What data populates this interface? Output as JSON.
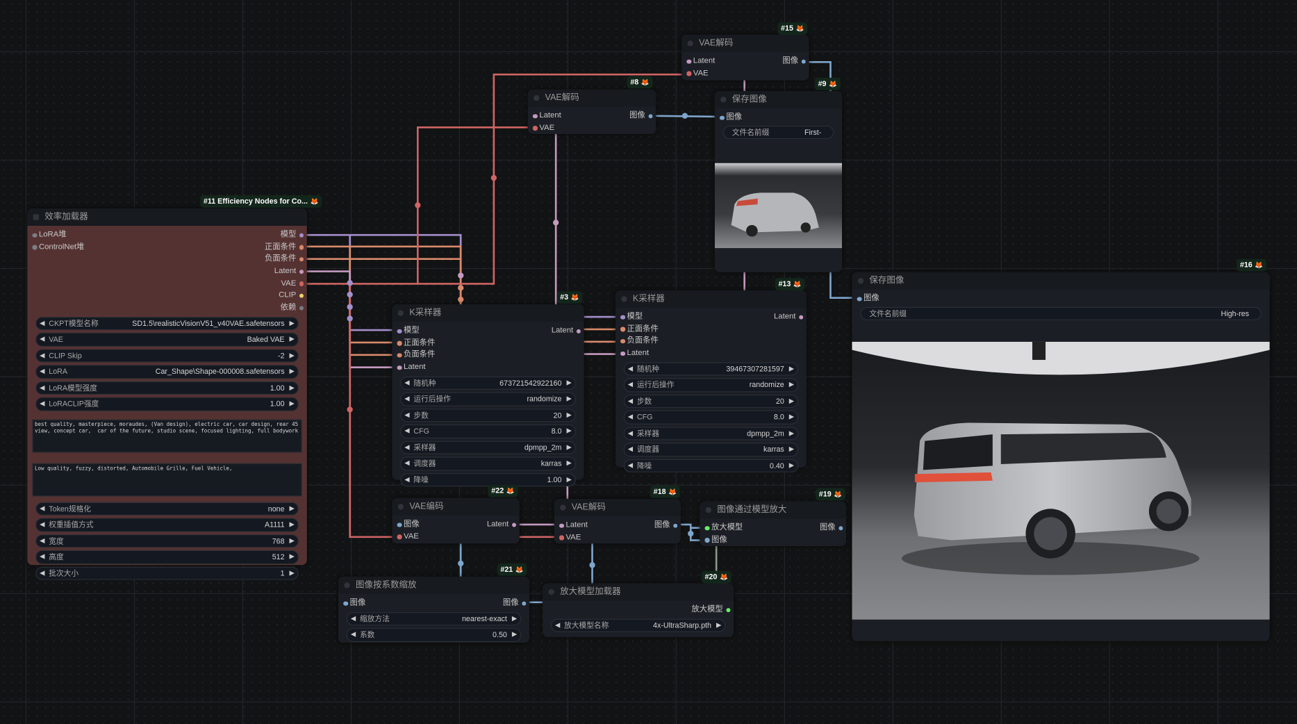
{
  "slot_colors": {
    "MODEL": "#a58fcb",
    "CONDITIONING": "#d88a6c",
    "LATENT": "#c49ac0",
    "VAE": "#d06464",
    "CLIP": "#eed66a",
    "IMAGE": "#7ea6cc",
    "UPSCALE_MODEL": "#66ee66",
    "DEPENDENCIES": "#7a7d86",
    "STACK": "#7a7d86"
  },
  "nodes": {
    "n11": {
      "badge": "#11 Efficiency Nodes for Co...",
      "title": "效率加载器",
      "rows": [
        {
          "in": "LoRA堆",
          "in_type": "STACK",
          "out": "模型",
          "out_type": "MODEL"
        },
        {
          "in": "ControlNet堆",
          "in_type": "STACK",
          "out": "正面条件",
          "out_type": "CONDITIONING"
        },
        {
          "out": "负面条件",
          "out_type": "CONDITIONING"
        },
        {
          "out": "Latent",
          "out_type": "LATENT"
        },
        {
          "out": "VAE",
          "out_type": "VAE"
        },
        {
          "out": "CLIP",
          "out_type": "CLIP"
        },
        {
          "out": "依赖",
          "out_type": "DEPENDENCIES"
        }
      ],
      "body": [
        {
          "label": "CKPT模型名称",
          "value": "SD1.5\\realisticVisionV51_v40VAE.safetensors"
        },
        {
          "label": "VAE",
          "value": "Baked VAE"
        },
        {
          "label": "CLIP Skip",
          "value": "-2"
        },
        {
          "label": "LoRA",
          "value": "Car_Shape\\Shape-000008.safetensors"
        },
        {
          "label": "LoRA模型强度",
          "value": "1.00"
        },
        {
          "label": "LoRACLIP强度",
          "value": "1.00"
        },
        {
          "text": "best quality, masterpiece, moraudes, (Van design), electric car, car design, rear 45 view, concept car,  car of the future, studio scene, focused lighting, full bodywork"
        },
        {
          "text": "Low quality, fuzzy, distorted, Automobile Grille, Fuel Vehicle,"
        },
        {
          "label": "Token规格化",
          "value": "none"
        },
        {
          "label": "权重插值方式",
          "value": "A1111"
        },
        {
          "label": "宽度",
          "value": "768"
        },
        {
          "label": "高度",
          "value": "512"
        },
        {
          "label": "批次大小",
          "value": "1"
        }
      ]
    },
    "n3": {
      "badge": "#3",
      "title": "K采样器",
      "rows": [
        {
          "in": "模型",
          "in_type": "MODEL",
          "out": "Latent",
          "out_type": "LATENT"
        },
        {
          "in": "正面条件",
          "in_type": "CONDITIONING"
        },
        {
          "in": "负面条件",
          "in_type": "CONDITIONING"
        },
        {
          "in": "Latent",
          "in_type": "LATENT"
        }
      ],
      "body": [
        {
          "label": "随机种",
          "value": "673721542922160"
        },
        {
          "label": "运行后操作",
          "value": "randomize"
        },
        {
          "label": "步数",
          "value": "20"
        },
        {
          "label": "CFG",
          "value": "8.0"
        },
        {
          "label": "采样器",
          "value": "dpmpp_2m"
        },
        {
          "label": "调度器",
          "value": "karras"
        },
        {
          "label": "降噪",
          "value": "1.00"
        }
      ]
    },
    "n13": {
      "badge": "#13",
      "title": "K采样器",
      "rows": [
        {
          "in": "模型",
          "in_type": "MODEL",
          "out": "Latent",
          "out_type": "LATENT"
        },
        {
          "in": "正面条件",
          "in_type": "CONDITIONING"
        },
        {
          "in": "负面条件",
          "in_type": "CONDITIONING"
        },
        {
          "in": "Latent",
          "in_type": "LATENT"
        }
      ],
      "body": [
        {
          "label": "随机种",
          "value": "39467307281597"
        },
        {
          "label": "运行后操作",
          "value": "randomize"
        },
        {
          "label": "步数",
          "value": "20"
        },
        {
          "label": "CFG",
          "value": "8.0"
        },
        {
          "label": "采样器",
          "value": "dpmpp_2m"
        },
        {
          "label": "调度器",
          "value": "karras"
        },
        {
          "label": "降噪",
          "value": "0.40"
        }
      ]
    },
    "n15": {
      "badge": "#15",
      "title": "VAE解码",
      "rows": [
        {
          "in": "Latent",
          "in_type": "LATENT",
          "out": "图像",
          "out_type": "IMAGE"
        },
        {
          "in": "VAE",
          "in_type": "VAE"
        }
      ],
      "body": []
    },
    "n8": {
      "badge": "#8",
      "title": "VAE解码",
      "rows": [
        {
          "in": "Latent",
          "in_type": "LATENT",
          "out": "图像",
          "out_type": "IMAGE"
        },
        {
          "in": "VAE",
          "in_type": "VAE"
        }
      ],
      "body": []
    },
    "n9": {
      "badge": "#9",
      "title": "保存图像",
      "rows": [
        {
          "in": "图像",
          "in_type": "IMAGE"
        }
      ],
      "body": [
        {
          "label": "文件名前缀",
          "value": "First-",
          "plain": true
        }
      ]
    },
    "n16": {
      "badge": "#16",
      "title": "保存图像",
      "rows": [
        {
          "in": "图像",
          "in_type": "IMAGE"
        }
      ],
      "body": [
        {
          "label": "文件名前缀",
          "value": "High-res",
          "plain": true
        }
      ]
    },
    "n22": {
      "badge": "#22",
      "title": "VAE编码",
      "rows": [
        {
          "in": "图像",
          "in_type": "IMAGE",
          "out": "Latent",
          "out_type": "LATENT"
        },
        {
          "in": "VAE",
          "in_type": "VAE"
        }
      ],
      "body": []
    },
    "n18": {
      "badge": "#18",
      "title": "VAE解码",
      "rows": [
        {
          "in": "Latent",
          "in_type": "LATENT",
          "out": "图像",
          "out_type": "IMAGE"
        },
        {
          "in": "VAE",
          "in_type": "VAE"
        }
      ],
      "body": []
    },
    "n19": {
      "badge": "#19",
      "title": "图像通过模型放大",
      "rows": [
        {
          "in": "放大模型",
          "in_type": "UPSCALE_MODEL",
          "out": "图像",
          "out_type": "IMAGE"
        },
        {
          "in": "图像",
          "in_type": "IMAGE"
        }
      ],
      "body": []
    },
    "n21": {
      "badge": "#21",
      "title": "图像按系数缩放",
      "rows": [
        {
          "in": "图像",
          "in_type": "IMAGE",
          "out": "图像",
          "out_type": "IMAGE"
        }
      ],
      "body": [
        {
          "label": "缩放方法",
          "value": "nearest-exact"
        },
        {
          "label": "系数",
          "value": "0.50"
        }
      ]
    },
    "n20": {
      "badge": "#20",
      "title": "放大模型加载器",
      "rows": [
        {
          "out": "放大模型",
          "out_type": "UPSCALE_MODEL"
        }
      ],
      "body": [
        {
          "label": "放大模型名称",
          "value": "4x-UltraSharp.pth"
        }
      ]
    }
  }
}
